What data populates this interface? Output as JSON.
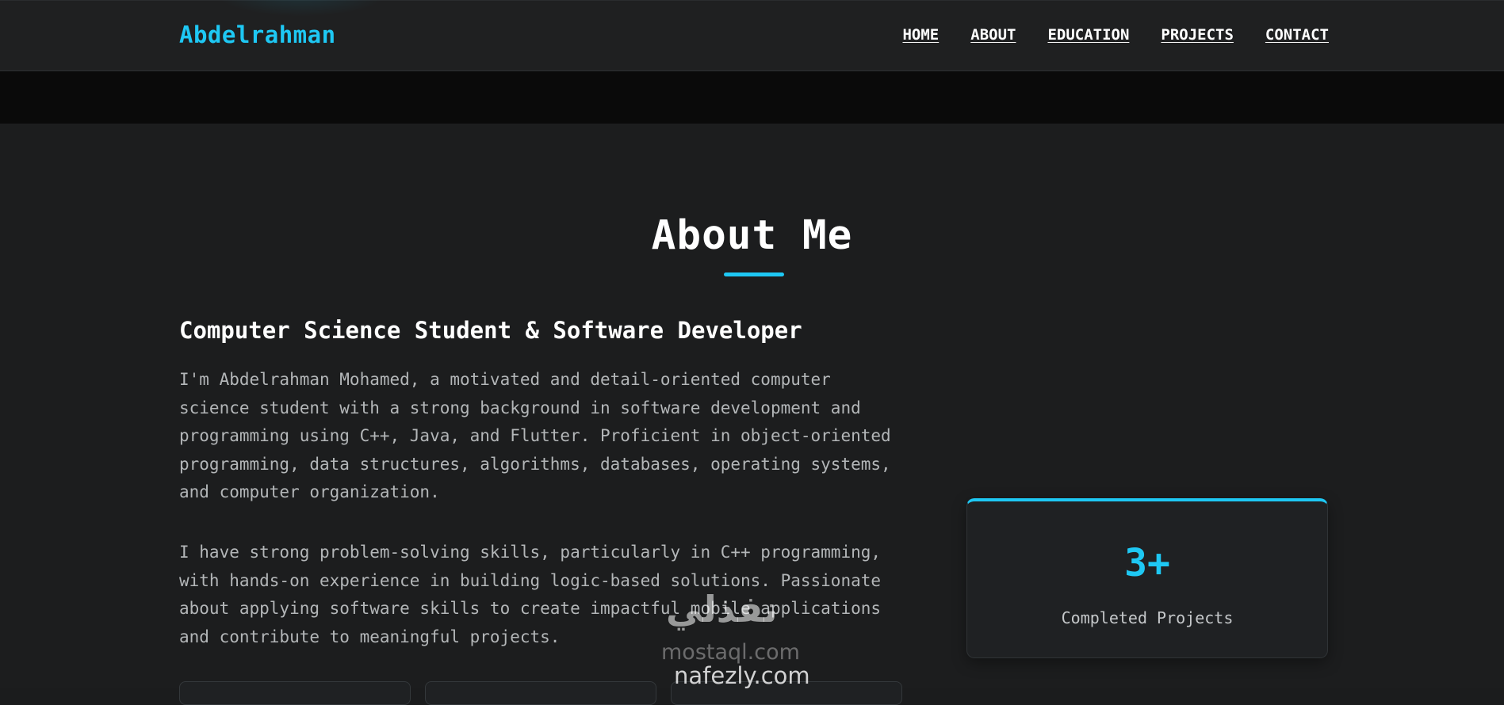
{
  "nav": {
    "logo": "Abdelrahman",
    "links": [
      "HOME",
      "ABOUT",
      "EDUCATION",
      "PROJECTS",
      "CONTACT"
    ]
  },
  "about": {
    "title": "About Me",
    "subtitle": "Computer Science Student & Software Developer",
    "paragraphs": [
      "I'm Abdelrahman Mohamed, a motivated and detail-oriented computer science student with a strong background in software development and programming using C++, Java, and Flutter. Proficient in object-oriented programming, data structures, algorithms, databases, operating systems, and computer organization.",
      "I have strong problem-solving skills, particularly in C++ programming, with hands-on experience in building logic-based solutions. Passionate about applying software skills to create impactful mobile applications and contribute to meaningful projects."
    ],
    "stat": {
      "value": "3+",
      "label": "Completed Projects"
    }
  },
  "watermark": {
    "arabic": "نفذلي",
    "line1": "mostaql.com",
    "line2": "nafezly.com"
  },
  "colors": {
    "accent": "#1ec8f4",
    "background": "#1c1d1e",
    "navbar": "#1f2021"
  }
}
